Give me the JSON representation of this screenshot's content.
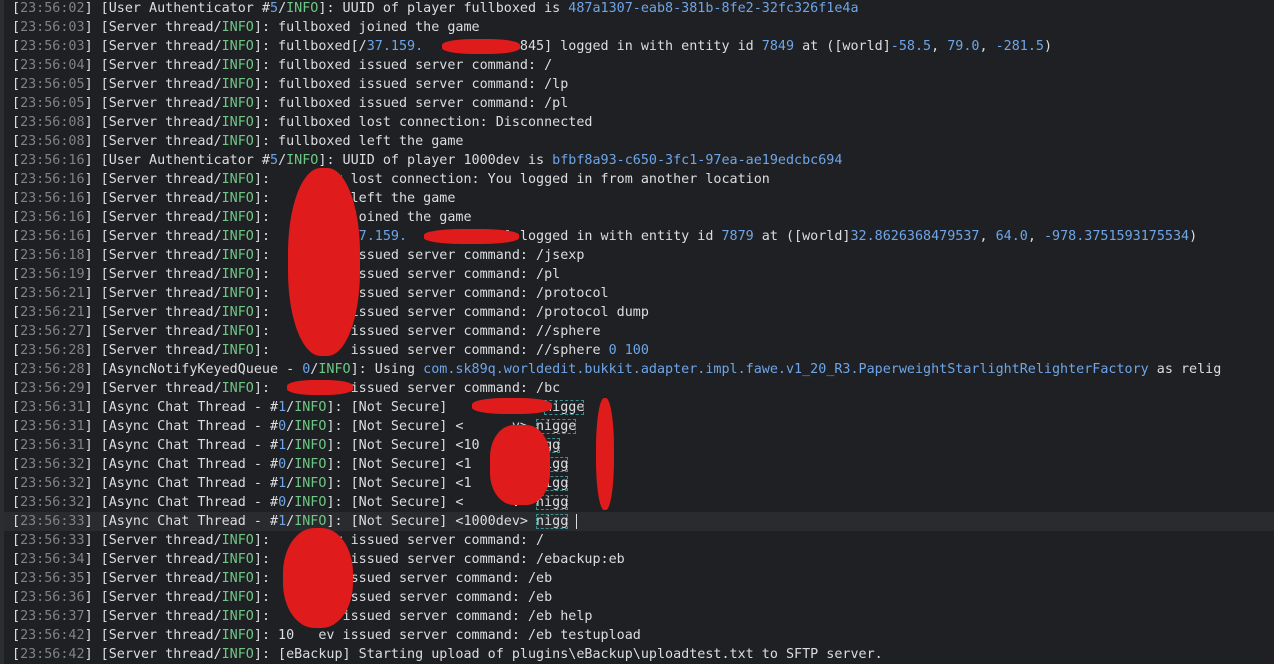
{
  "colors": {
    "background": "#1f2023",
    "text": "#dcdde0",
    "timestamp": "#808287",
    "info_level": "#6fc785",
    "number": "#6ea5e8",
    "redaction": "#e01b1b"
  },
  "log_lines": [
    {
      "ts": "23:56:02",
      "src": "User Authenticator #",
      "srcnum": "5",
      "lvl": "INFO",
      "pre": ": UUID of player fullboxed is ",
      "hl": "487a1307-eab8-381b-8fe2-32fc326f1e4a",
      "post": ""
    },
    {
      "ts": "23:56:03",
      "src": "Server thread",
      "srcnum": "",
      "lvl": "INFO",
      "pre": ": fullboxed joined the game",
      "hl": "",
      "post": ""
    },
    {
      "ts": "23:56:03",
      "src": "Server thread",
      "srcnum": "",
      "lvl": "INFO",
      "pre": ": fullboxed[/",
      "hl": "37.159.",
      "post": "            845] logged in with entity id ",
      "n1": "7849",
      "mid": " at ([world]",
      "n2": "-58.5",
      "sep1": ", ",
      "n3": "79.0",
      "sep2": ", ",
      "n4": "-281.5",
      "end": ")"
    },
    {
      "ts": "23:56:04",
      "src": "Server thread",
      "srcnum": "",
      "lvl": "INFO",
      "pre": ": fullboxed issued server command: /",
      "hl": "",
      "post": ""
    },
    {
      "ts": "23:56:05",
      "src": "Server thread",
      "srcnum": "",
      "lvl": "INFO",
      "pre": ": fullboxed issued server command: /lp",
      "hl": "",
      "post": ""
    },
    {
      "ts": "23:56:05",
      "src": "Server thread",
      "srcnum": "",
      "lvl": "INFO",
      "pre": ": fullboxed issued server command: /pl",
      "hl": "",
      "post": ""
    },
    {
      "ts": "23:56:08",
      "src": "Server thread",
      "srcnum": "",
      "lvl": "INFO",
      "pre": ": fullboxed lost connection: Disconnected",
      "hl": "",
      "post": ""
    },
    {
      "ts": "23:56:08",
      "src": "Server thread",
      "srcnum": "",
      "lvl": "INFO",
      "pre": ": fullboxed left the game",
      "hl": "",
      "post": ""
    },
    {
      "ts": "23:56:16",
      "src": "User Authenticator #",
      "srcnum": "5",
      "lvl": "INFO",
      "pre": ": UUID of player 1000dev is ",
      "hl": "bfbf8a93-c650-3fc1-97ea-ae19edcbc694",
      "post": ""
    },
    {
      "ts": "23:56:16",
      "src": "Server thread",
      "srcnum": "",
      "lvl": "INFO",
      "pre": ":        v lost connection: You logged in from another location",
      "hl": "",
      "post": ""
    },
    {
      "ts": "23:56:16",
      "src": "Server thread",
      "srcnum": "",
      "lvl": "INFO",
      "pre": ":          left the game",
      "hl": "",
      "post": ""
    },
    {
      "ts": "23:56:16",
      "src": "Server thread",
      "srcnum": "",
      "lvl": "INFO",
      "pre": ":        v joined the game",
      "hl": "",
      "post": ""
    },
    {
      "ts": "23:56:16",
      "src": "Server thread",
      "srcnum": "",
      "lvl": "INFO",
      "pre": ":        [/",
      "hl": "37.159.",
      "post": "           4] logged in with entity id ",
      "n1": "7879",
      "mid": " at ([world]",
      "n2": "32.8626368479537",
      "sep1": ", ",
      "n3": "64.0",
      "sep2": ", ",
      "n4": "-978.3751593175534",
      "end": ")"
    },
    {
      "ts": "23:56:18",
      "src": "Server thread",
      "srcnum": "",
      "lvl": "INFO",
      "pre": ":          issued server command: /jsexp",
      "hl": "",
      "post": ""
    },
    {
      "ts": "23:56:19",
      "src": "Server thread",
      "srcnum": "",
      "lvl": "INFO",
      "pre": ":          issued server command: /pl",
      "hl": "",
      "post": ""
    },
    {
      "ts": "23:56:21",
      "src": "Server thread",
      "srcnum": "",
      "lvl": "INFO",
      "pre": ":          issued server command: /protocol",
      "hl": "",
      "post": ""
    },
    {
      "ts": "23:56:21",
      "src": "Server thread",
      "srcnum": "",
      "lvl": "INFO",
      "pre": ":          issued server command: /protocol dump",
      "hl": "",
      "post": ""
    },
    {
      "ts": "23:56:27",
      "src": "Server thread",
      "srcnum": "",
      "lvl": "INFO",
      "pre": ":          issued server command: //sphere",
      "hl": "",
      "post": ""
    },
    {
      "ts": "23:56:28",
      "src": "Server thread",
      "srcnum": "",
      "lvl": "INFO",
      "pre": ":          issued server command: //sphere ",
      "hl": "",
      "post": "",
      "n1": "0",
      "mid": " ",
      "n2": "100"
    },
    {
      "ts": "23:56:28",
      "src": "AsyncNotifyKeyedQueue - ",
      "srcnum": "0",
      "lvl": "INFO",
      "pre": ": Using ",
      "hl": "com.sk89q.worldedit.bukkit.adapter.impl.fawe.v1_20_R3.PaperweightStarlightRelighterFactory",
      "post": " as relig"
    },
    {
      "ts": "23:56:29",
      "src": "Server thread",
      "srcnum": "",
      "lvl": "INFO",
      "pre": ":          issued server command: /bc",
      "hl": "",
      "post": ""
    },
    {
      "ts": "23:56:31",
      "src": "Async Chat Thread - #",
      "srcnum": "1",
      "lvl": "INFO",
      "pre": ": [Not Secure]            ",
      "hl": "",
      "post": "",
      "chat": "nigge"
    },
    {
      "ts": "23:56:31",
      "src": "Async Chat Thread - #",
      "srcnum": "0",
      "lvl": "INFO",
      "pre": ": [Not Secure] <      v> ",
      "hl": "",
      "post": "",
      "chat": "nigge"
    },
    {
      "ts": "23:56:31",
      "src": "Async Chat Thread - #",
      "srcnum": "1",
      "lvl": "INFO",
      "pre": ": [Not Secure] <10      ",
      "hl": "",
      "post": "",
      "chat": "nigg"
    },
    {
      "ts": "23:56:32",
      "src": "Async Chat Thread - #",
      "srcnum": "0",
      "lvl": "INFO",
      "pre": ": [Not Secure] <1     v> ",
      "hl": "",
      "post": "",
      "chat": "nigg"
    },
    {
      "ts": "23:56:32",
      "src": "Async Chat Thread - #",
      "srcnum": "1",
      "lvl": "INFO",
      "pre": ": [Not Secure] <1     v> ",
      "hl": "",
      "post": "",
      "chat": "nigg"
    },
    {
      "ts": "23:56:32",
      "src": "Async Chat Thread - #",
      "srcnum": "0",
      "lvl": "INFO",
      "pre": ": [Not Secure] <      v> ",
      "hl": "",
      "post": "",
      "chat": "nigg"
    },
    {
      "ts": "23:56:33",
      "src": "Async Chat Thread - #",
      "srcnum": "1",
      "lvl": "INFO",
      "pre": ": [Not Secure] <1000dev> ",
      "hl": "",
      "post": "",
      "chat": "nigg",
      "caret": true
    },
    {
      "ts": "23:56:33",
      "src": "Server thread",
      "srcnum": "",
      "lvl": "INFO",
      "pre": ":        v issued server command: /",
      "hl": "",
      "post": ""
    },
    {
      "ts": "23:56:34",
      "src": "Server thread",
      "srcnum": "",
      "lvl": "INFO",
      "pre": ":          issued server command: /ebackup:eb",
      "hl": "",
      "post": ""
    },
    {
      "ts": "23:56:35",
      "src": "Server thread",
      "srcnum": "",
      "lvl": "INFO",
      "pre": ":       v issued server command: /eb",
      "hl": "",
      "post": ""
    },
    {
      "ts": "23:56:36",
      "src": "Server thread",
      "srcnum": "",
      "lvl": "INFO",
      "pre": ":       v issued server command: /eb",
      "hl": "",
      "post": ""
    },
    {
      "ts": "23:56:37",
      "src": "Server thread",
      "srcnum": "",
      "lvl": "INFO",
      "pre": ":       v issued server command: /eb help",
      "hl": "",
      "post": ""
    },
    {
      "ts": "23:56:42",
      "src": "Server thread",
      "srcnum": "",
      "lvl": "INFO",
      "pre": ": 10   ev issued server command: /eb testupload",
      "hl": "",
      "post": ""
    },
    {
      "ts": "23:56:42",
      "src": "Server thread",
      "srcnum": "",
      "lvl": "INFO",
      "pre": ": [eBackup] Starting upload of plugins\\eBackup\\uploadtest.txt to SFTP server.",
      "hl": "",
      "post": ""
    }
  ]
}
